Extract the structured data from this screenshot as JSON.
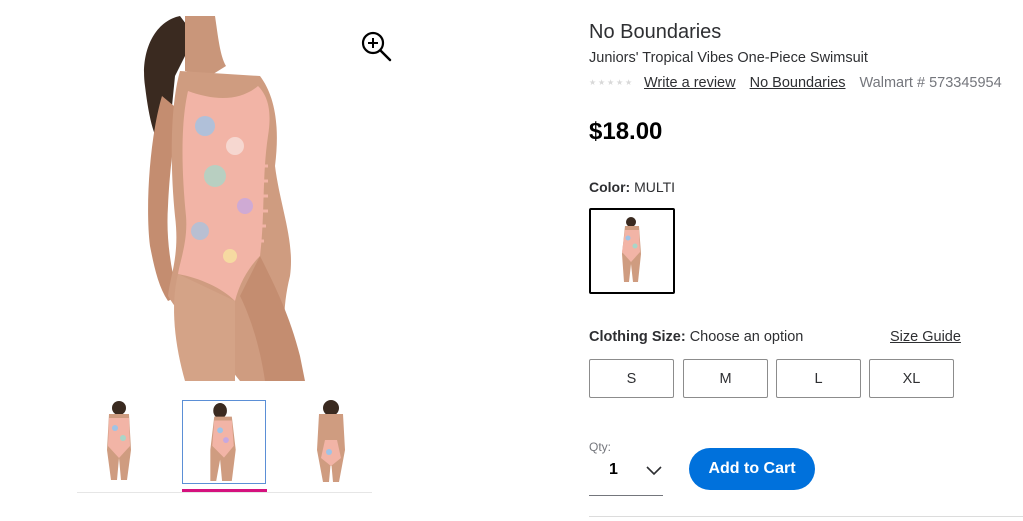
{
  "gallery": {
    "main_image_alt": "Model wearing Juniors' Tropical Vibes One-Piece Swimsuit, side view",
    "zoom_icon": "zoom-in-icon",
    "thumbnails": [
      {
        "view": "front",
        "selected": false
      },
      {
        "view": "side",
        "selected": true
      },
      {
        "view": "back",
        "selected": false
      }
    ],
    "selected_indicator_color": "#d5117e"
  },
  "product": {
    "brand": "No Boundaries",
    "title": "Juniors' Tropical Vibes One-Piece Swimsuit",
    "rating_stars": 0,
    "write_review": "Write a review",
    "brand_link": "No Boundaries",
    "walmart_number": "Walmart # 573345954",
    "price": "$18.00"
  },
  "color": {
    "label": "Color:",
    "value": "MULTI"
  },
  "size": {
    "label": "Clothing Size:",
    "prompt": "Choose an option",
    "guide_link": "Size Guide",
    "options": [
      "S",
      "M",
      "L",
      "XL"
    ]
  },
  "quantity": {
    "label": "Qty:",
    "value": "1"
  },
  "cart": {
    "add_label": "Add to Cart",
    "button_color": "#0071dc"
  }
}
